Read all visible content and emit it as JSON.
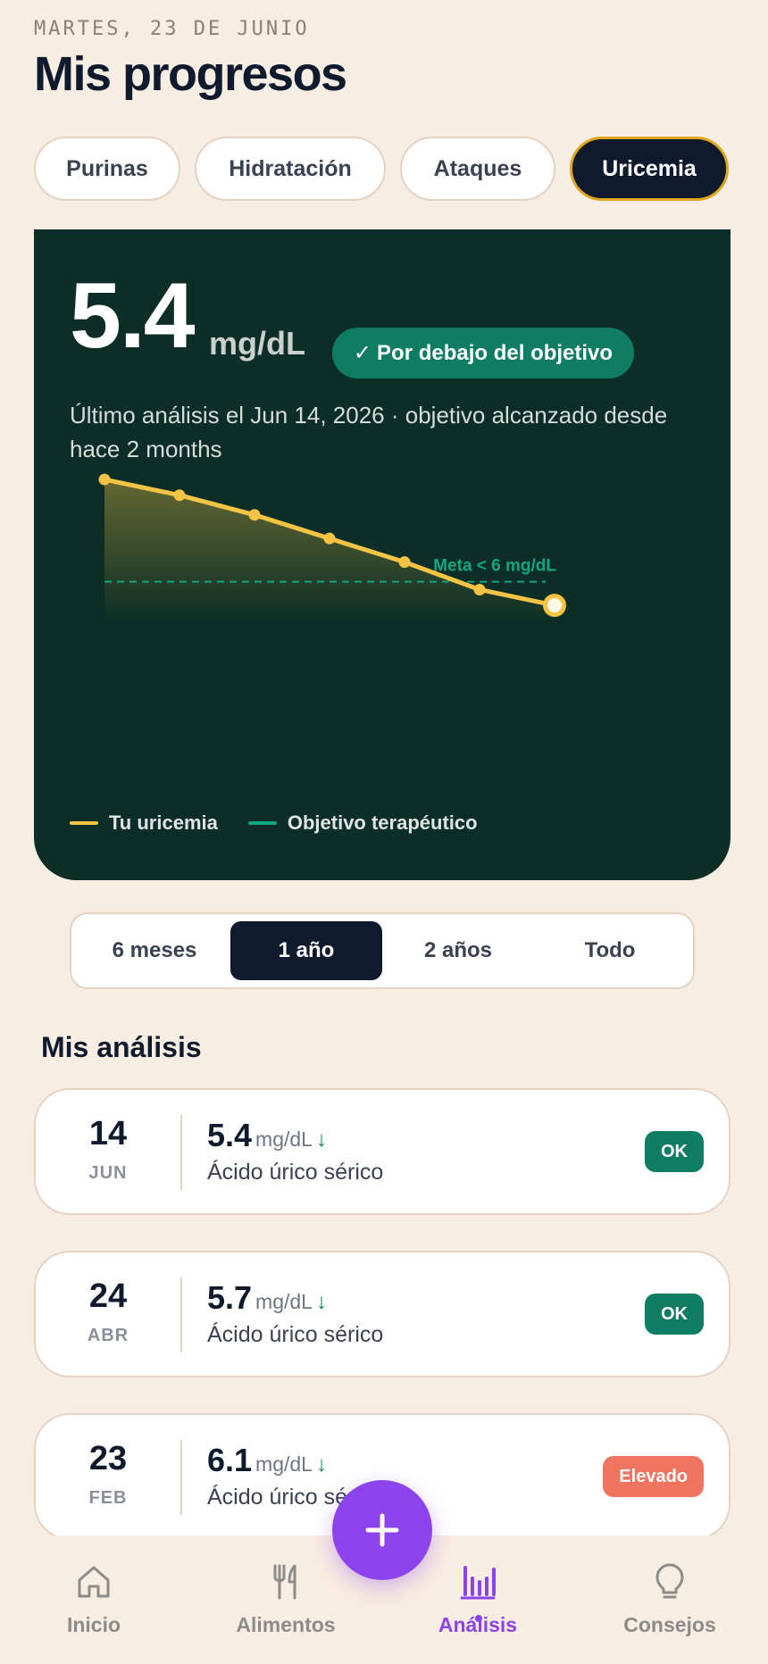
{
  "header": {
    "date": "MARTES, 23 DE JUNIO",
    "title": "Mis progresos"
  },
  "tabs": [
    {
      "label": "Purinas"
    },
    {
      "label": "Hidratación"
    },
    {
      "label": "Ataques"
    },
    {
      "label": "Uricemia",
      "active": true
    }
  ],
  "summary": {
    "value": "5.4",
    "unit": "mg/dL",
    "status_check": "✓",
    "status": "Por debajo del objetivo",
    "subtitle": "Último análisis el Jun 14, 2026 · objetivo alcanzado desde hace 2 months"
  },
  "chart_data": {
    "type": "area",
    "series": [
      {
        "name": "Tu uricemia",
        "values": [
          8.6,
          8.2,
          7.7,
          7.1,
          6.5,
          5.8,
          5.4
        ]
      }
    ],
    "target": {
      "name": "Objetivo terapéutico",
      "value": 6,
      "label": "Meta < 6 mg/dL"
    },
    "ylim": [
      4.2,
      9.6
    ],
    "legend": "bottom-left",
    "colors": {
      "series": "#f5c444",
      "target": "#10a67e"
    }
  },
  "range": {
    "options": [
      "6 meses",
      "1 año",
      "2 años",
      "Todo"
    ],
    "active_index": 1
  },
  "analyses": {
    "title": "Mis análisis",
    "items": [
      {
        "day": "14",
        "month": "JUN",
        "value": "5.4",
        "unit": "mg/dL",
        "arrow": "↓",
        "label": "Ácido úrico sérico",
        "badge": "OK",
        "status": "ok"
      },
      {
        "day": "24",
        "month": "ABR",
        "value": "5.7",
        "unit": "mg/dL",
        "arrow": "↓",
        "label": "Ácido úrico sérico",
        "badge": "OK",
        "status": "ok"
      },
      {
        "day": "23",
        "month": "FEB",
        "value": "6.1",
        "unit": "mg/dL",
        "arrow": "↓",
        "label": "Ácido úrico sérico",
        "badge": "Elevado",
        "status": "high"
      }
    ]
  },
  "nav": {
    "items": [
      {
        "label": "Inicio",
        "icon": "home-icon"
      },
      {
        "label": "Alimentos",
        "icon": "fork-knife-icon"
      },
      {
        "label": "Análisis",
        "icon": "bar-chart-icon",
        "active": true
      },
      {
        "label": "Consejos",
        "icon": "lightbulb-icon"
      }
    ]
  },
  "colors": {
    "background": "#f8ede2",
    "card": "#0c2e26",
    "accent": "#8c43eb",
    "ok": "#0e7d63",
    "high": "#ee7460"
  }
}
